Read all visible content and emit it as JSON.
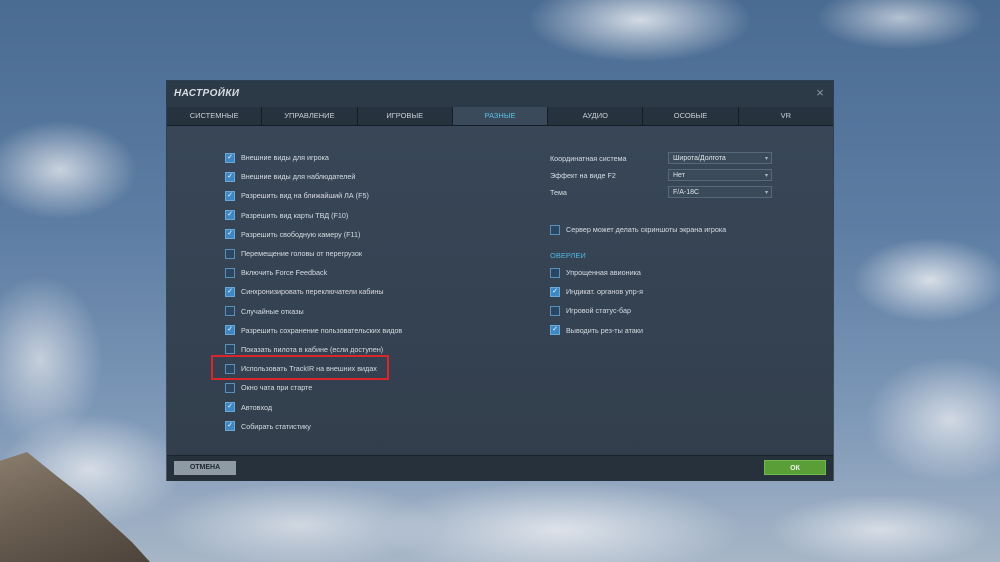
{
  "dialog": {
    "title": "НАСТРОЙКИ",
    "close_glyph": "×"
  },
  "tabs": [
    {
      "label": "СИСТЕМНЫЕ",
      "active": false
    },
    {
      "label": "УПРАВЛЕНИЕ",
      "active": false
    },
    {
      "label": "ИГРОВЫЕ",
      "active": false
    },
    {
      "label": "РАЗНЫЕ",
      "active": true
    },
    {
      "label": "АУДИО",
      "active": false
    },
    {
      "label": "ОСОБЫЕ",
      "active": false
    },
    {
      "label": "VR",
      "active": false
    }
  ],
  "left_options": [
    {
      "label": "Внешние виды для игрока",
      "checked": true
    },
    {
      "label": "Внешние виды для наблюдателей",
      "checked": true
    },
    {
      "label": "Разрешить вид на ближайший ЛА (F5)",
      "checked": true
    },
    {
      "label": "Разрешить вид карты ТВД (F10)",
      "checked": true
    },
    {
      "label": "Разрешить свободную камеру (F11)",
      "checked": true
    },
    {
      "label": "Перемещение головы от перегрузок",
      "checked": false
    },
    {
      "label": "Включить Force Feedback",
      "checked": false
    },
    {
      "label": "Синхронизировать переключатели кабины",
      "checked": true
    },
    {
      "label": "Случайные отказы",
      "checked": false
    },
    {
      "label": "Разрешить сохранение пользовательских видов",
      "checked": true
    },
    {
      "label": "Показать пилота в кабине (если доступен)",
      "checked": false
    },
    {
      "label": "Использовать TrackIR на внешних видах",
      "checked": false
    },
    {
      "label": "Окно чата при старте",
      "checked": false
    },
    {
      "label": "Автовход",
      "checked": true
    },
    {
      "label": "Собирать статистику",
      "checked": true
    }
  ],
  "selects": [
    {
      "label": "Координатная система",
      "value": "Широта/Долгота"
    },
    {
      "label": "Эффект на виде F2",
      "value": "Нет"
    },
    {
      "label": "Тема",
      "value": "F/A-18C"
    }
  ],
  "server_screenshot": {
    "label": "Сервер может делать скриншоты экрана игрока",
    "checked": false
  },
  "overlays": {
    "title": "ОВЕРЛЕИ",
    "items": [
      {
        "label": "Упрощенная авионика",
        "checked": false
      },
      {
        "label": "Индикат. органов упр-я",
        "checked": true
      },
      {
        "label": "Игровой статус-бар",
        "checked": false
      },
      {
        "label": "Выводить рез-ты атаки",
        "checked": true
      }
    ]
  },
  "footer": {
    "cancel_label": "ОТМЕНА",
    "ok_label": "ОК"
  },
  "colors": {
    "accent_tab": "#5ac0e8",
    "ok_button": "#5a9e38",
    "highlight_box": "#d8262c"
  },
  "icons": {
    "check": "✓",
    "dropdown": "▾"
  }
}
